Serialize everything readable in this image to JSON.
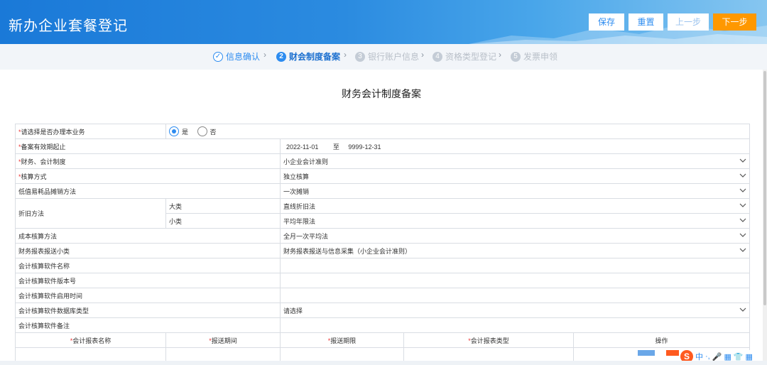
{
  "app": {
    "title": "新办企业套餐登记"
  },
  "toolbar": {
    "save": "保存",
    "reset": "重置",
    "prev": "上一步",
    "next": "下一步"
  },
  "steps": [
    {
      "num": "✓",
      "label": "信息确认"
    },
    {
      "num": "2",
      "label": "财会制度备案"
    },
    {
      "num": "3",
      "label": "银行账户信息"
    },
    {
      "num": "4",
      "label": "资格类型登记"
    },
    {
      "num": "5",
      "label": "发票申领"
    }
  ],
  "step_separator": "›",
  "page": {
    "title": "财务会计制度备案"
  },
  "form": {
    "handle": {
      "label": "请选择是否办理本业务",
      "yes": "是",
      "no": "否",
      "selected": "是"
    },
    "period": {
      "label": "备案有效期起止",
      "start": "2022-11-01",
      "to": "至",
      "end": "9999-12-31"
    },
    "system": {
      "label": "财务、会计制度",
      "value": "小企业会计准则"
    },
    "accounting": {
      "label": "核算方式",
      "value": "独立核算"
    },
    "amortization": {
      "label": "低值易耗品摊销方法",
      "value": "一次摊销"
    },
    "depreciation": {
      "label": "折旧方法",
      "major_label": "大类",
      "major_value": "直线折旧法",
      "minor_label": "小类",
      "minor_value": "平均年限法"
    },
    "cost": {
      "label": "成本核算方法",
      "value": "全月一次平均法"
    },
    "report_sub": {
      "label": "财务报表报送小类",
      "value": "财务报表报送与信息采集（小企业会计准则）"
    },
    "software_name": {
      "label": "会计核算软件名称",
      "value": ""
    },
    "software_version": {
      "label": "会计核算软件版本号",
      "value": ""
    },
    "software_start": {
      "label": "会计核算软件启用时间",
      "value": ""
    },
    "software_db": {
      "label": "会计核算软件数据库类型",
      "value": "请选择"
    },
    "software_note": {
      "label": "会计核算软件备注",
      "value": ""
    }
  },
  "report_table": {
    "headers": [
      "会计报表名称",
      "报送期间",
      "报送期限",
      "会计报表类型",
      "操作"
    ]
  },
  "ime": {
    "items": [
      "S",
      "中",
      "·,",
      "🎤",
      "▦",
      "👕",
      "▦"
    ]
  }
}
